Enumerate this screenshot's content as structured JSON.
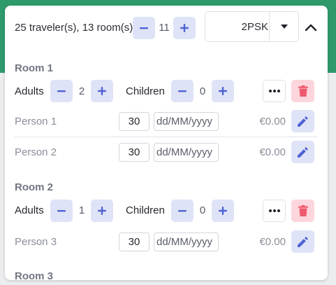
{
  "header": {
    "summary": "25 traveler(s), 13 room(s)",
    "count": "11",
    "fare_value": "2PSK"
  },
  "rooms": [
    {
      "title": "Room 1",
      "adults_label": "Adults",
      "adults": "2",
      "children_label": "Children",
      "children": "0",
      "persons": [
        {
          "name": "Person 1",
          "age": "30",
          "date_placeholder": "dd/MM/yyyy",
          "price": "€0.00"
        },
        {
          "name": "Person 2",
          "age": "30",
          "date_placeholder": "dd/MM/yyyy",
          "price": "€0.00"
        }
      ]
    },
    {
      "title": "Room 2",
      "adults_label": "Adults",
      "adults": "1",
      "children_label": "Children",
      "children": "0",
      "persons": [
        {
          "name": "Person 3",
          "age": "30",
          "date_placeholder": "dd/MM/yyyy",
          "price": "€0.00"
        }
      ]
    },
    {
      "title": "Room 3"
    }
  ],
  "icons": {
    "minus": "minus-icon",
    "plus": "plus-icon",
    "caret": "caret-down-icon",
    "collapse": "chevron-up-icon",
    "more": "more-horizontal-icon",
    "trash": "trash-icon",
    "pencil": "pencil-icon"
  },
  "colors": {
    "header_green": "#2e9a6b",
    "stepper_bg": "#dfe3f7",
    "stepper_icon": "#4f63d2",
    "delete_bg": "#fcd6dc",
    "delete_icon": "#ef5a6f"
  }
}
